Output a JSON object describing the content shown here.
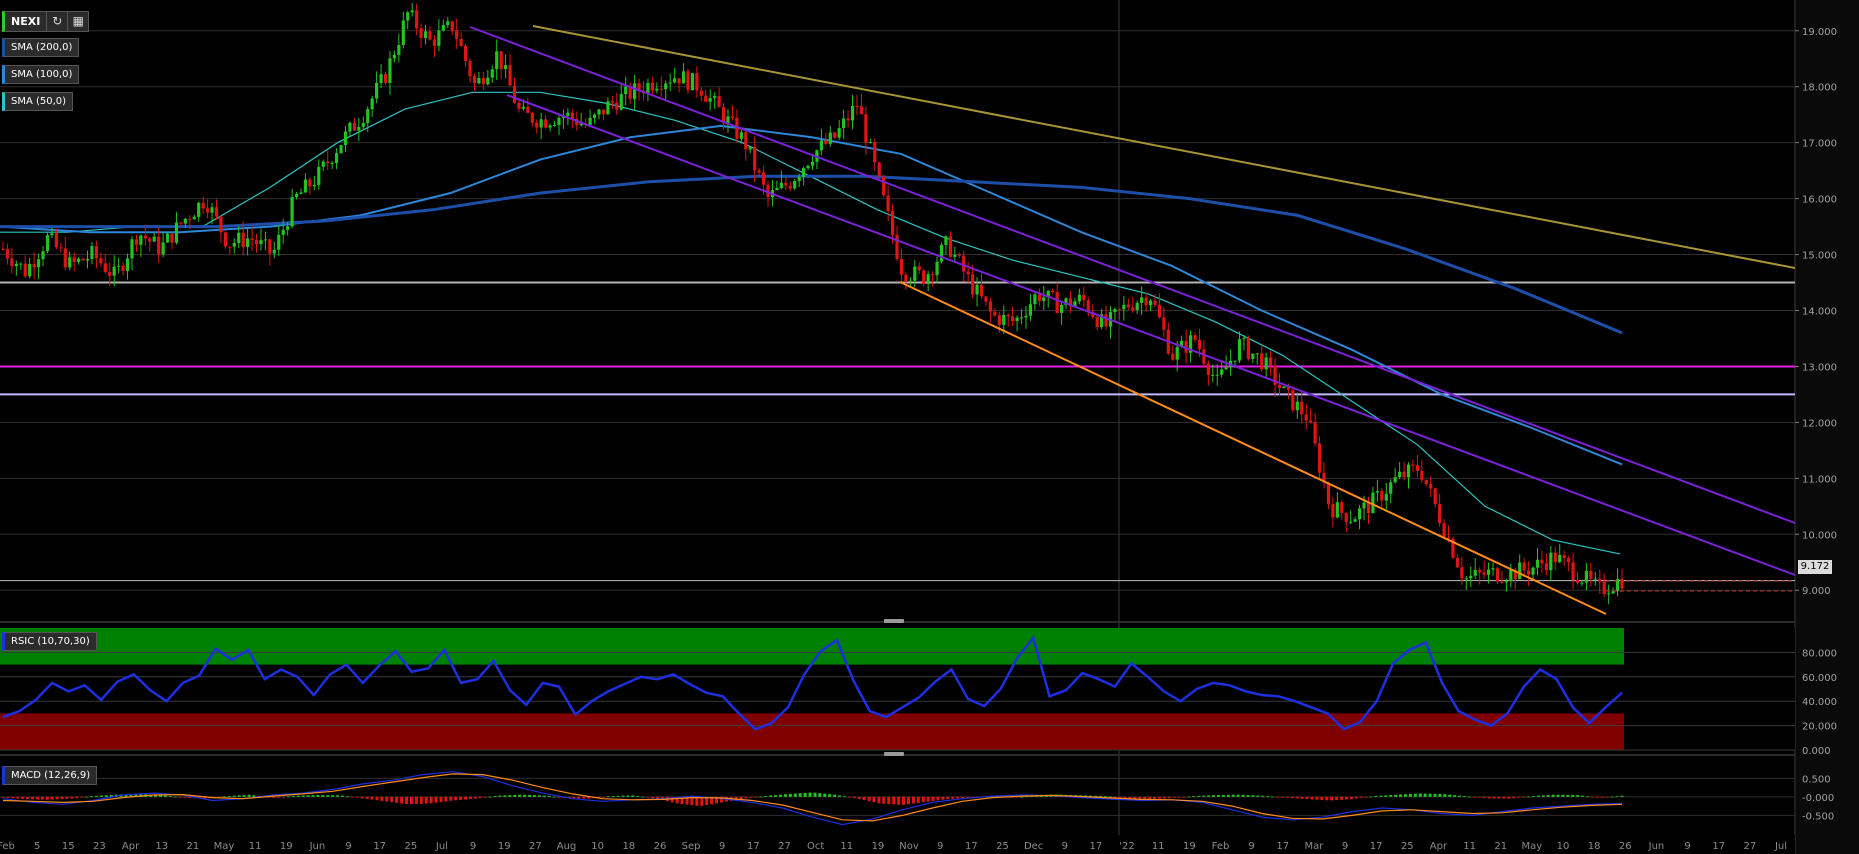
{
  "toolbar": {
    "ticker": "NEXI",
    "refresh_icon": "refresh-icon",
    "calendar_icon": "calendar-icon"
  },
  "indicators": {
    "sma200": {
      "label": "SMA (200,0)",
      "color": "#1e4fa8"
    },
    "sma100": {
      "label": "SMA (100,0)",
      "color": "#2f86d8"
    },
    "sma50": {
      "label": "SMA (50,0)",
      "color": "#2ec4c4"
    },
    "rsi": {
      "label": "RSIC (10,70,30)",
      "color": "#1d2fe0"
    },
    "macd": {
      "label": "MACD (12,26,9)",
      "color": "#1d2fe0"
    }
  },
  "price_tag": "9.172",
  "colors": {
    "up": "#22c322",
    "down": "#e01414",
    "trend_gold": "#a89438",
    "channel_purple": "#7a22d8",
    "support_orange": "#ff8c1a",
    "level_magenta": "#e41ee4",
    "level_lavender": "#c0b8ff",
    "level_gray": "#b4b4b4",
    "rsi_overbought_zone": "#008000",
    "rsi_oversold_zone": "#800000",
    "macd_signal": "#ff8c1a"
  },
  "chart_data": [
    {
      "type": "candlestick",
      "y_ticks": [
        "9.000",
        "10.000",
        "11.000",
        "12.000",
        "13.000",
        "14.000",
        "15.000",
        "16.000",
        "17.000",
        "18.000",
        "19.000"
      ],
      "ylim": [
        8.45,
        19.55
      ],
      "x_ticks": [
        "Feb",
        "5",
        "15",
        "23",
        "Apr",
        "13",
        "21",
        "May",
        "11",
        "19",
        "Jun",
        "9",
        "17",
        "25",
        "Jul",
        "9",
        "19",
        "27",
        "Aug",
        "10",
        "18",
        "26",
        "Sep",
        "9",
        "17",
        "27",
        "Oct",
        "11",
        "19",
        "Nov",
        "9",
        "17",
        "25",
        "Dec",
        "9",
        "17",
        "'22",
        "11",
        "19",
        "Feb",
        "9",
        "17",
        "Mar",
        "9",
        "17",
        "25",
        "Apr",
        "11",
        "21",
        "May",
        "10",
        "18",
        "26",
        "Jun",
        "9",
        "17",
        "27",
        "Jul"
      ],
      "last_price": 9.172,
      "price_path": [
        15.1,
        14.7,
        15.3,
        14.8,
        15.0,
        14.6,
        15.4,
        15.1,
        15.6,
        16.0,
        15.2,
        15.3,
        15.0,
        16.0,
        16.4,
        17.0,
        17.5,
        18.2,
        19.3,
        18.8,
        19.1,
        18.0,
        18.6,
        17.5,
        17.4,
        17.5,
        17.3,
        17.7,
        17.9,
        18.1,
        18.2,
        18.0,
        17.5,
        17.0,
        16.0,
        16.3,
        16.8,
        17.1,
        17.7,
        16.2,
        14.7,
        14.6,
        15.2,
        14.5,
        13.9,
        13.8,
        14.3,
        14.1,
        14.2,
        13.7,
        14.1,
        14.3,
        13.2,
        13.5,
        12.7,
        13.4,
        13.1,
        12.5,
        12.1,
        10.5,
        10.3,
        10.6,
        11.0,
        11.2,
        10.2,
        9.2,
        9.3,
        9.3,
        9.4,
        9.6,
        9.3,
        9.0,
        9.2
      ],
      "horizontal_levels": [
        14.5,
        13.0,
        12.5
      ],
      "sma50": [
        15.4,
        15.4,
        15.5,
        15.5,
        16.2,
        17.0,
        17.6,
        17.9,
        17.9,
        17.7,
        17.4,
        17.0,
        16.4,
        15.8,
        15.3,
        14.9,
        14.6,
        14.3,
        13.8,
        13.2,
        12.4,
        11.6,
        10.5,
        9.9,
        9.65
      ],
      "sma100": [
        15.5,
        15.4,
        15.4,
        15.5,
        15.7,
        16.1,
        16.7,
        17.1,
        17.3,
        17.1,
        16.8,
        16.1,
        15.4,
        14.8,
        14.0,
        13.3,
        12.5,
        11.9,
        11.25
      ],
      "sma200": [
        15.5,
        15.5,
        15.5,
        15.6,
        15.8,
        16.1,
        16.3,
        16.4,
        16.4,
        16.3,
        16.2,
        16.0,
        15.7,
        15.1,
        14.4,
        13.6
      ]
    },
    {
      "type": "line",
      "title": "RSIC (10,70,30)",
      "y_ticks": [
        "0.000",
        "20.000",
        "40.000",
        "60.000",
        "80.000"
      ],
      "ylim": [
        0,
        100
      ],
      "overbought": 70,
      "oversold": 30,
      "values": [
        27,
        32,
        41,
        55,
        48,
        53,
        41,
        56,
        62,
        49,
        40,
        55,
        61,
        83,
        74,
        82,
        58,
        66,
        60,
        45,
        62,
        70,
        55,
        69,
        81,
        64,
        67,
        82,
        55,
        58,
        73,
        49,
        37,
        55,
        52,
        29,
        40,
        48,
        54,
        60,
        58,
        62,
        54,
        47,
        44,
        30,
        17,
        22,
        35,
        62,
        81,
        90,
        57,
        32,
        27,
        35,
        43,
        56,
        66,
        42,
        36,
        50,
        75,
        92,
        44,
        49,
        63,
        58,
        52,
        71,
        60,
        48,
        40,
        50,
        55,
        53,
        48,
        45,
        44,
        40,
        35,
        30,
        17,
        23,
        40,
        71,
        82,
        88,
        55,
        32,
        25,
        20,
        30,
        52,
        66,
        58,
        35,
        22,
        35,
        47
      ]
    },
    {
      "type": "bar",
      "title": "MACD (12,26,9)",
      "y_ticks": [
        "0.500",
        "-0.000",
        "-0.500"
      ],
      "ylim": [
        -0.95,
        1.05
      ],
      "histogram": [
        -0.02,
        -0.06,
        -0.08,
        -0.05,
        0.02,
        0.06,
        0.08,
        0.05,
        -0.02,
        -0.05,
        0.02,
        0.06,
        -0.03,
        0.03,
        0.05,
        0.04,
        -0.04,
        -0.12,
        -0.2,
        -0.18,
        -0.1,
        -0.05,
        0.03,
        0.06,
        0.04,
        -0.03,
        -0.05,
        0.02,
        0.04,
        -0.04,
        -0.18,
        -0.25,
        -0.15,
        -0.04,
        0.03,
        0.08,
        0.12,
        0.06,
        -0.05,
        -0.18,
        -0.22,
        -0.14,
        -0.06,
        -0.02,
        0.03,
        -0.02,
        0.05,
        0.06,
        0.04,
        0.02,
        -0.04,
        -0.06,
        -0.03,
        0.02,
        0.05,
        0.06,
        0.03,
        -0.02,
        -0.06,
        -0.1,
        -0.06,
        0.02,
        0.06,
        0.09,
        0.08,
        0.02,
        -0.04,
        -0.05,
        0.02,
        0.06,
        0.05,
        -0.03,
        0.03
      ],
      "macd_line": [
        -0.05,
        -0.15,
        -0.2,
        -0.1,
        0.05,
        0.1,
        0.05,
        -0.1,
        -0.05,
        0.05,
        0.1,
        0.2,
        0.35,
        0.45,
        0.6,
        0.68,
        0.55,
        0.3,
        0.1,
        -0.05,
        -0.12,
        -0.08,
        -0.05,
        0.02,
        -0.05,
        -0.15,
        -0.3,
        -0.55,
        -0.75,
        -0.6,
        -0.35,
        -0.15,
        -0.05,
        0.02,
        0.05,
        0.03,
        -0.02,
        -0.06,
        -0.1,
        -0.08,
        -0.15,
        -0.35,
        -0.55,
        -0.62,
        -0.55,
        -0.4,
        -0.3,
        -0.35,
        -0.45,
        -0.5,
        -0.4,
        -0.3,
        -0.25,
        -0.2,
        -0.18
      ],
      "signal_line": [
        -0.1,
        -0.12,
        -0.15,
        -0.12,
        -0.02,
        0.05,
        0.06,
        -0.02,
        -0.05,
        0.02,
        0.08,
        0.15,
        0.28,
        0.4,
        0.52,
        0.62,
        0.6,
        0.45,
        0.25,
        0.08,
        -0.05,
        -0.08,
        -0.07,
        -0.02,
        -0.03,
        -0.1,
        -0.22,
        -0.42,
        -0.62,
        -0.65,
        -0.5,
        -0.3,
        -0.12,
        -0.02,
        0.02,
        0.04,
        0.01,
        -0.03,
        -0.07,
        -0.08,
        -0.12,
        -0.25,
        -0.45,
        -0.58,
        -0.6,
        -0.5,
        -0.38,
        -0.35,
        -0.4,
        -0.45,
        -0.43,
        -0.35,
        -0.28,
        -0.23,
        -0.2
      ]
    }
  ]
}
